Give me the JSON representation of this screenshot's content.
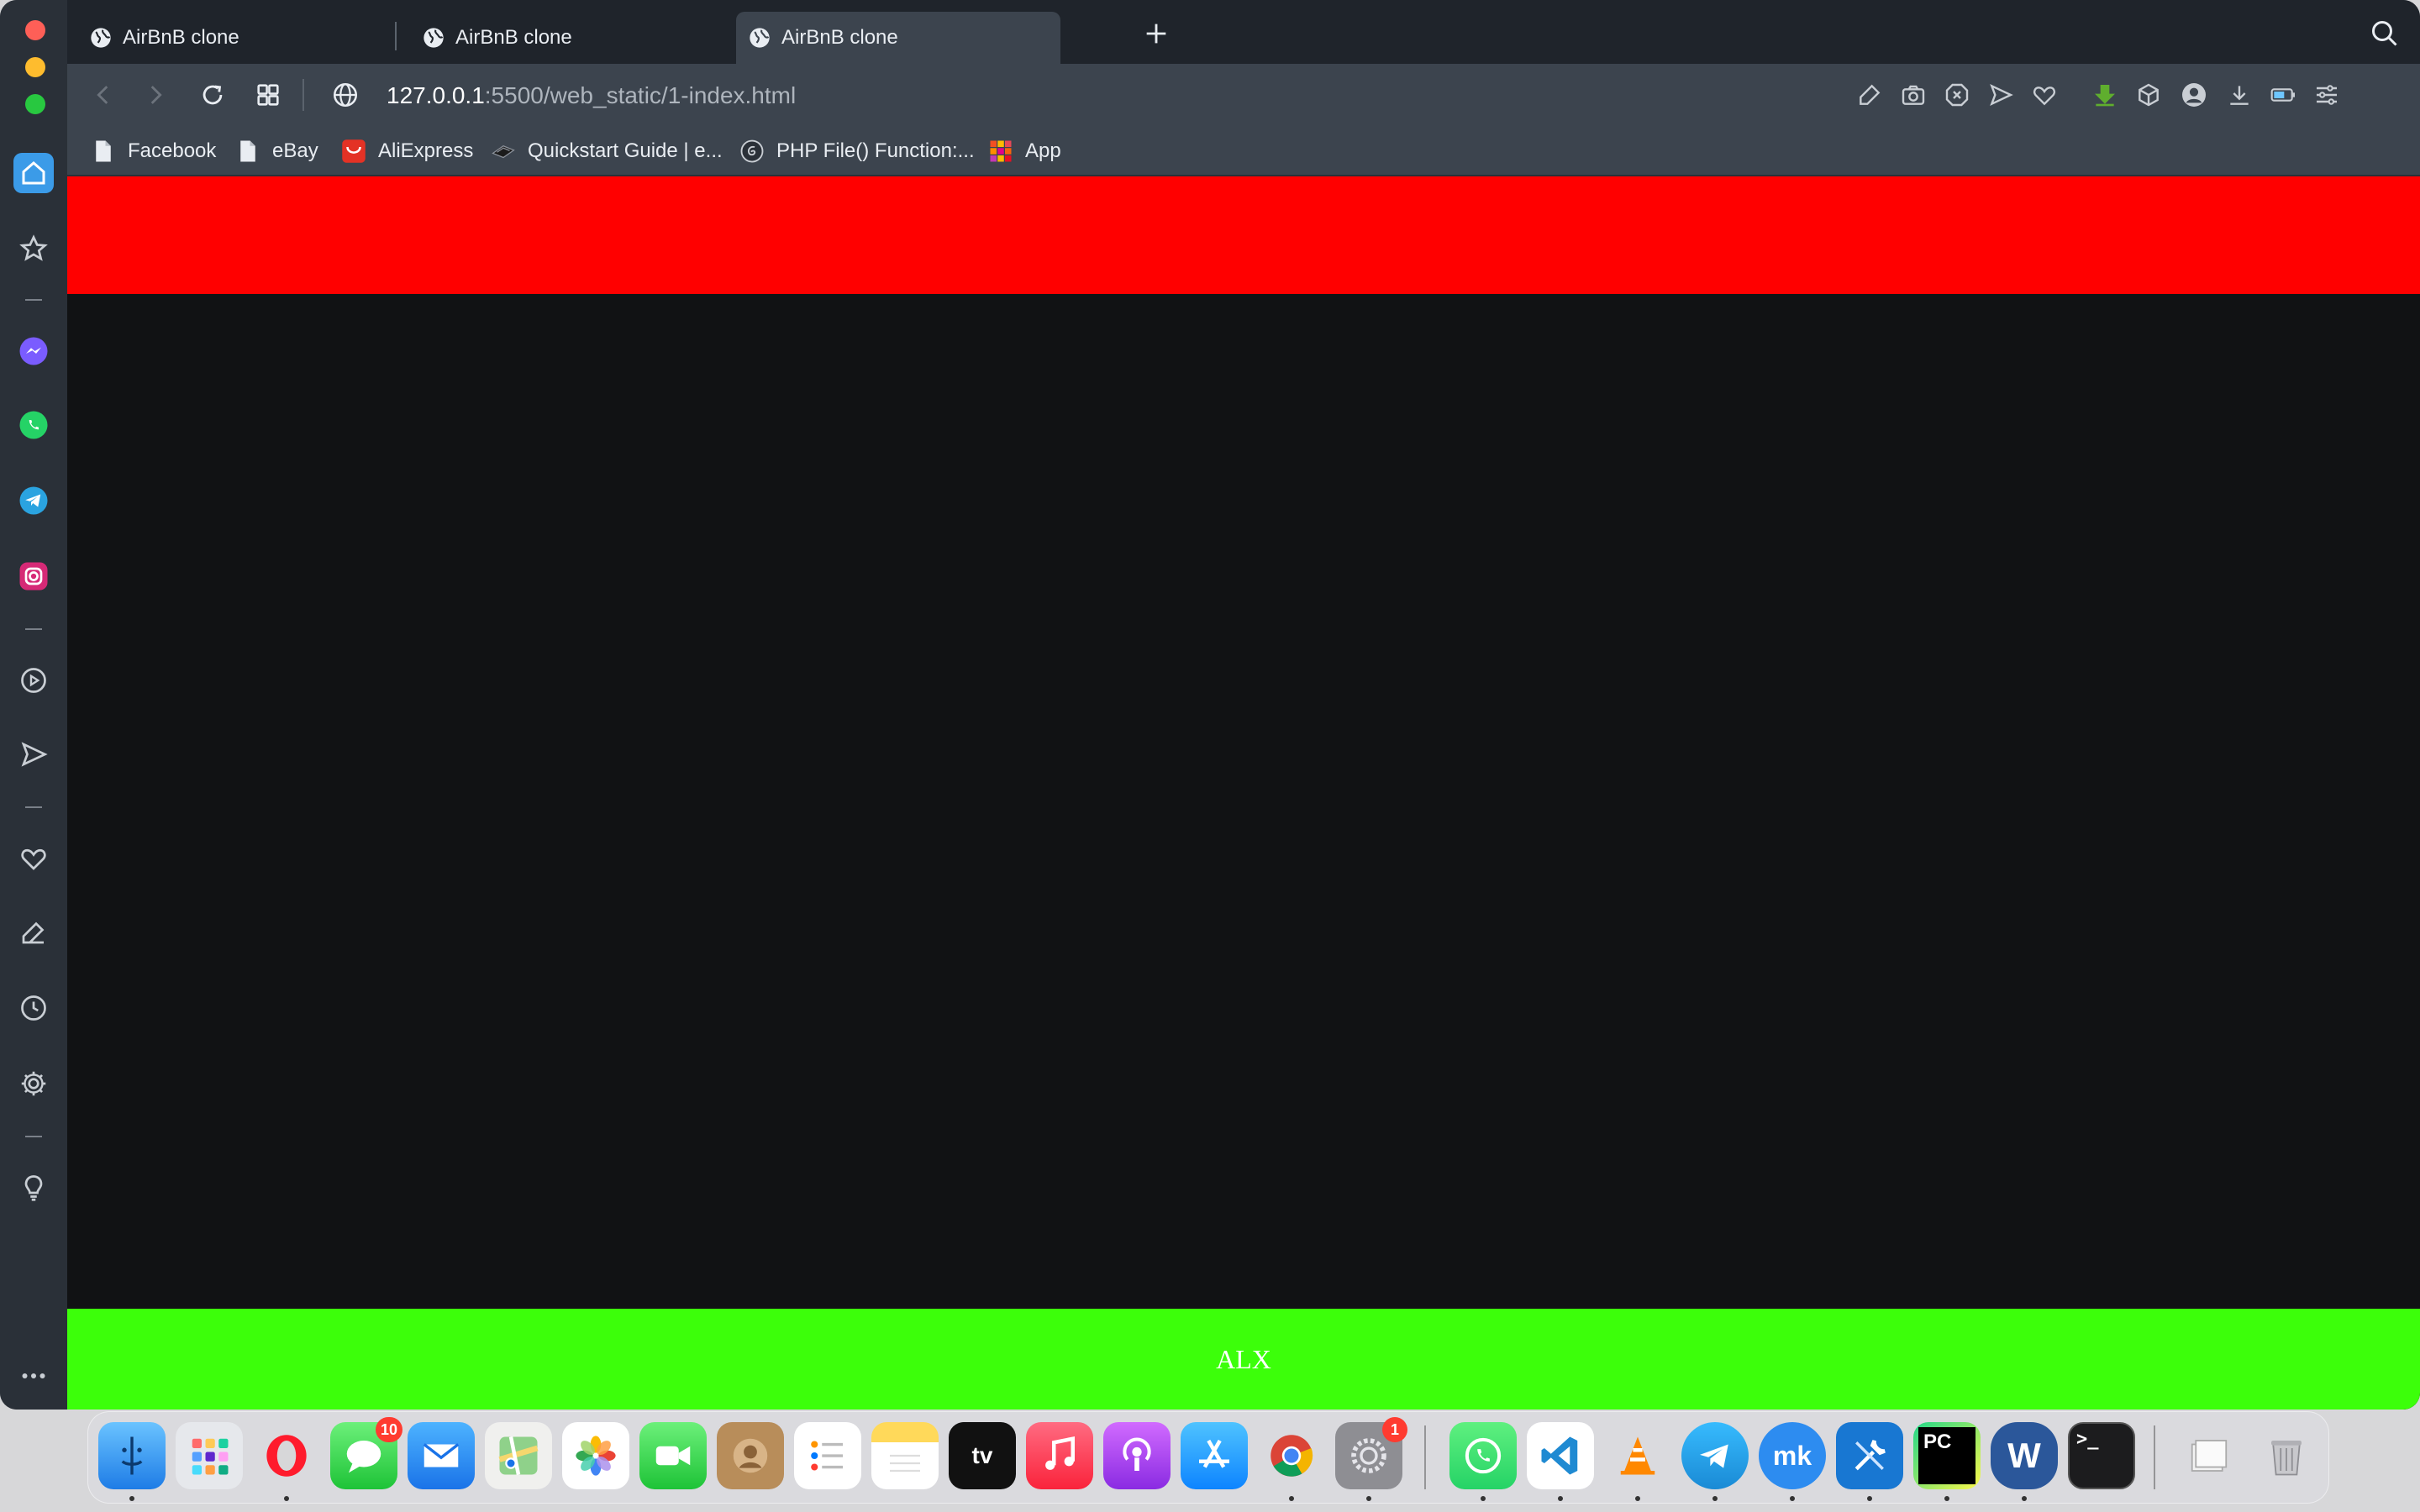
{
  "browser": {
    "tabs": [
      {
        "title": "AirBnB clone",
        "active": false
      },
      {
        "title": "AirBnB clone",
        "active": false
      },
      {
        "title": "AirBnB clone",
        "active": true
      }
    ],
    "url": {
      "host": "127.0.0.1",
      "rest": ":5500/web_static/1-index.html"
    },
    "bookmarks": [
      {
        "label": "Facebook",
        "icon": "page-icon"
      },
      {
        "label": "eBay",
        "icon": "page-icon"
      },
      {
        "label": "AliExpress",
        "icon": "aliexpress-icon"
      },
      {
        "label": "Quickstart Guide | e...",
        "icon": "quickstart-icon"
      },
      {
        "label": "PHP File() Function:...",
        "icon": "php-icon"
      },
      {
        "label": "App",
        "icon": "grid-icon"
      }
    ]
  },
  "page": {
    "header_color": "#ff0000",
    "body_color": "#111214",
    "footer_color": "#3cff0a",
    "footer_text": "ALX"
  },
  "dock": {
    "messages_badge": "10",
    "settings_badge": "1",
    "tv_label": "tv",
    "pycharm_label": "PC",
    "word_label": "W",
    "terminal_label": ">_",
    "mk_label": "mk"
  }
}
